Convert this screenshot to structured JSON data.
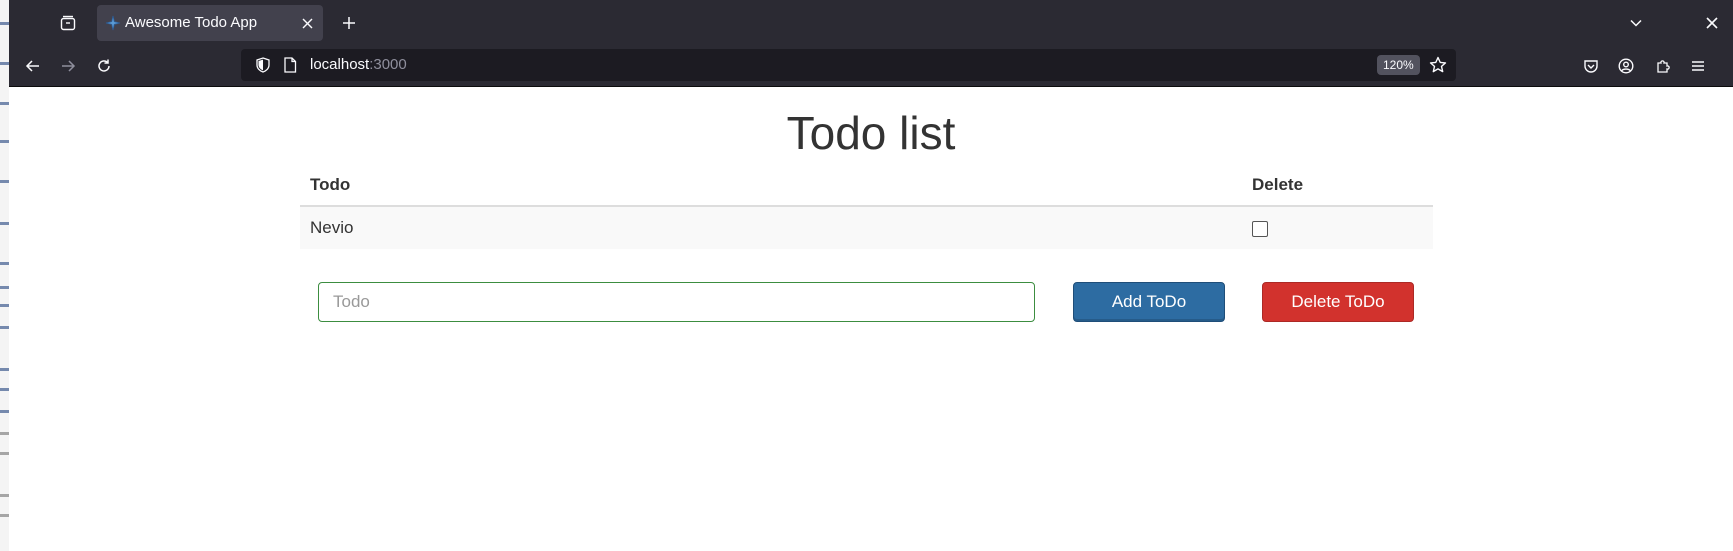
{
  "browser": {
    "tab": {
      "title": "Awesome Todo App"
    },
    "url": {
      "host": "localhost",
      "port": ":3000"
    },
    "zoom": "120%"
  },
  "page": {
    "title": "Todo list",
    "table": {
      "headers": {
        "todo": "Todo",
        "delete": "Delete"
      },
      "rows": [
        {
          "todo": "Nevio",
          "checked": false
        }
      ]
    },
    "input": {
      "placeholder": "Todo",
      "value": ""
    },
    "buttons": {
      "add": "Add ToDo",
      "delete": "Delete ToDo"
    }
  },
  "colors": {
    "add_button": "#2d6ca2",
    "delete_button": "#d2322d",
    "input_border": "#3c8d40",
    "browser_chrome": "#2b2a33"
  },
  "icons": [
    "tab-overview-icon",
    "favicon-icon",
    "close-icon",
    "plus-icon",
    "chevron-down-icon",
    "back-icon",
    "forward-icon",
    "reload-icon",
    "shield-icon",
    "page-icon",
    "star-icon",
    "pocket-icon",
    "account-icon",
    "extensions-icon",
    "menu-icon"
  ]
}
